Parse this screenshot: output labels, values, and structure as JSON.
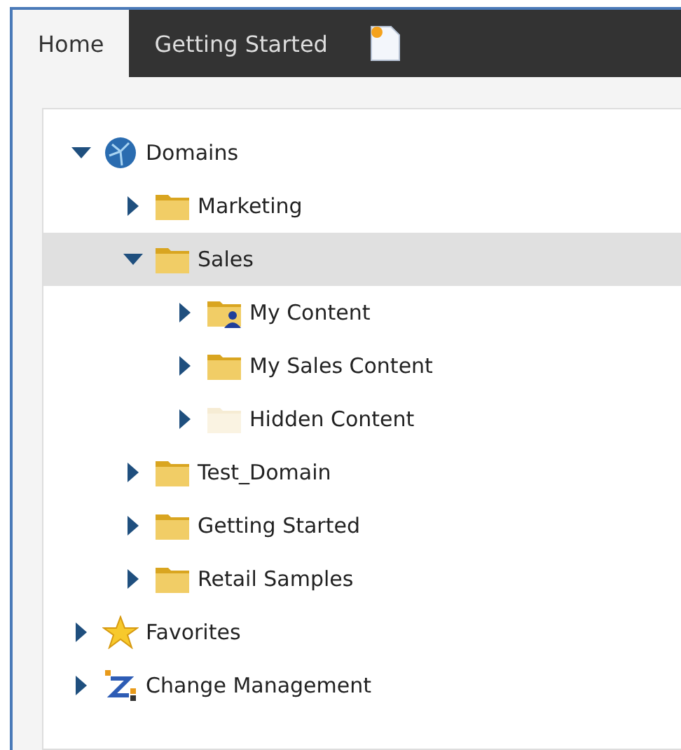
{
  "tabs": [
    {
      "label": "Home",
      "selected": true
    },
    {
      "label": "Getting Started",
      "selected": false
    }
  ],
  "tree": [
    {
      "label": "Domains",
      "kind": "globe",
      "expanded": true,
      "selected": false,
      "children": [
        {
          "label": "Marketing",
          "kind": "folder",
          "expanded": false,
          "selected": false
        },
        {
          "label": "Sales",
          "kind": "folder",
          "expanded": true,
          "selected": true,
          "children": [
            {
              "label": "My Content",
              "kind": "userfolder",
              "expanded": false,
              "selected": false
            },
            {
              "label": "My Sales Content",
              "kind": "folder",
              "expanded": false,
              "selected": false
            },
            {
              "label": "Hidden Content",
              "kind": "hidden",
              "expanded": false,
              "selected": false
            }
          ]
        },
        {
          "label": "Test_Domain",
          "kind": "folder",
          "expanded": false,
          "selected": false
        },
        {
          "label": "Getting Started",
          "kind": "folder",
          "expanded": false,
          "selected": false
        },
        {
          "label": "Retail Samples",
          "kind": "folder",
          "expanded": false,
          "selected": false
        }
      ]
    },
    {
      "label": "Favorites",
      "kind": "star",
      "expanded": false,
      "selected": false
    },
    {
      "label": "Change Management",
      "kind": "change",
      "expanded": false,
      "selected": false
    }
  ]
}
